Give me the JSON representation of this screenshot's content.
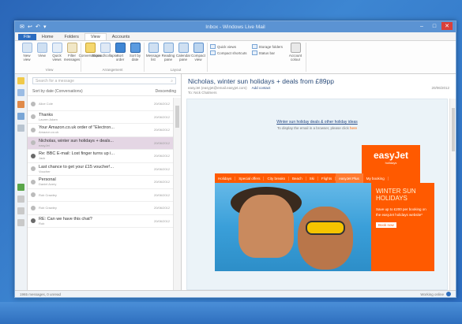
{
  "window": {
    "title": "Inbox - Windows Live Mail"
  },
  "tabs": [
    "File",
    "Home",
    "Folders",
    "View",
    "Accounts"
  ],
  "ribbon": {
    "groups": [
      {
        "label": "View",
        "buttons": [
          "New view",
          "View",
          "Quick views",
          "Filter messages"
        ]
      },
      {
        "label": "Arrangement",
        "buttons": [
          "Conversations",
          "Expand/collapse",
          "Sort order",
          "Sort by date"
        ]
      },
      {
        "label": "Layout",
        "buttons": [
          "Message list",
          "Reading pane",
          "Calendar pane",
          "Compact view"
        ]
      }
    ],
    "options": [
      "Quick views",
      "Compact shortcuts",
      "Storage folders",
      "Status bar",
      "Account colour"
    ]
  },
  "search": {
    "placeholder": "Search for a message"
  },
  "sort": {
    "left": "Sort by date (Conversations)",
    "right": "Descending"
  },
  "messages": [
    {
      "subject": "",
      "from": "Alice Cole",
      "date": "20/06/2012"
    },
    {
      "subject": "Thanks",
      "from": "Lauren Adam",
      "date": "20/06/2012"
    },
    {
      "subject": "Your Amazon.co.uk order of \"Electron...",
      "from": "Amazon.co.uk",
      "date": "20/06/2012"
    },
    {
      "subject": "Nicholas, winter sun holidays + deals...",
      "from": "easyJet",
      "date": "20/06/2012"
    },
    {
      "subject": "Re: BBC E-mail: Lost finger turns up i...",
      "from": "Jack",
      "date": "20/06/2012"
    },
    {
      "subject": "Last chance to get your £15 voucher!...",
      "from": "Voucher",
      "date": "20/06/2012"
    },
    {
      "subject": "Personal",
      "from": "Daniel Avery",
      "date": "20/06/2012"
    },
    {
      "subject": "",
      "from": "Rob Crawley",
      "date": "20/06/2012"
    },
    {
      "subject": "",
      "from": "Rob Crawley",
      "date": "20/06/2012"
    },
    {
      "subject": "RE: Can we have this chat?",
      "from": "Rob",
      "date": "20/06/2012"
    }
  ],
  "reading": {
    "subject": "Nicholas, winter sun holidays + deals from £89pp",
    "from": "easyJet (easyjet@email.easyjet.com)",
    "add_contact": "Add contact",
    "date": "20/06/2012",
    "to": "To: Nick Chalmers",
    "promo_link": "Winter sun holiday deals & other holiday ideas",
    "promo_sub_pre": "To display the email in a browser, please click",
    "promo_sub_link": "here",
    "logo": "easyJet",
    "logo_sub": "holidays",
    "nav": [
      "Holidays",
      "Special offers",
      "City breaks",
      "Beach",
      "Ski",
      "Flights",
      "easyJet Plus",
      "My booking"
    ],
    "promo_head": "WINTER SUN HOLIDAYS",
    "promo_text": "Save up to £200 per booking on the easyJet holidays website*",
    "promo_btn": "Book now"
  },
  "status": {
    "left": "1965 messages, 0 unread",
    "right": "Working online"
  }
}
